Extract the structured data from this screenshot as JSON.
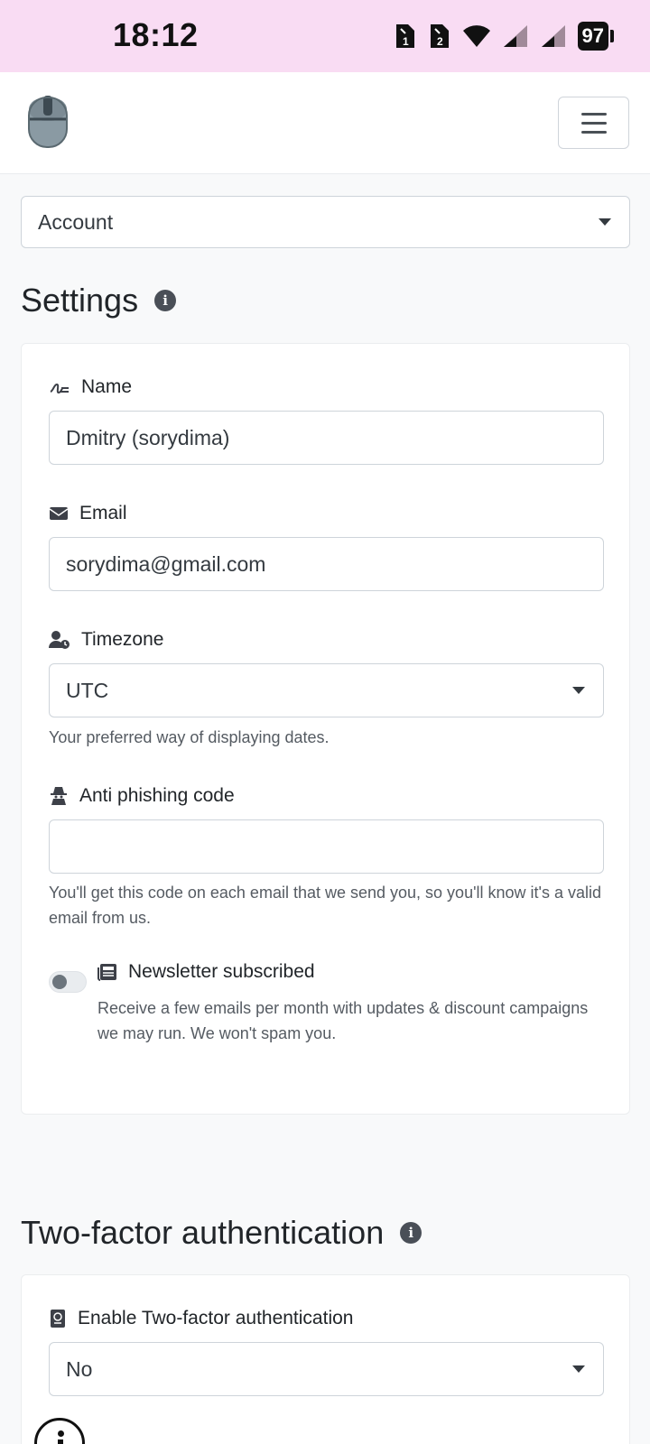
{
  "status_bar": {
    "time": "18:12",
    "battery": "97",
    "sim1": "1",
    "sim2": "2"
  },
  "navbar": {
    "logo": "mouse-logo-icon",
    "menu": "hamburger-menu-icon"
  },
  "section_select": {
    "value": "Account"
  },
  "settings": {
    "title": "Settings",
    "info_glyph": "i",
    "fields": {
      "name": {
        "label": "Name",
        "value": "Dmitry (sorydima)"
      },
      "email": {
        "label": "Email",
        "value": "sorydima@gmail.com"
      },
      "timezone": {
        "label": "Timezone",
        "value": "UTC",
        "help": "Your preferred way of displaying dates."
      },
      "anti_phishing": {
        "label": "Anti phishing code",
        "value": "",
        "help": "You'll get this code on each email that we send you, so you'll know it's a valid email from us."
      },
      "newsletter": {
        "label": "Newsletter subscribed",
        "help": "Receive a few emails per month with updates & discount campaigns we may run. We won't spam you.",
        "checked": false
      }
    }
  },
  "two_factor": {
    "title": "Two-factor authentication",
    "info_glyph": "i",
    "enable_label": "Enable Two-factor authentication",
    "enable_value": "No"
  }
}
